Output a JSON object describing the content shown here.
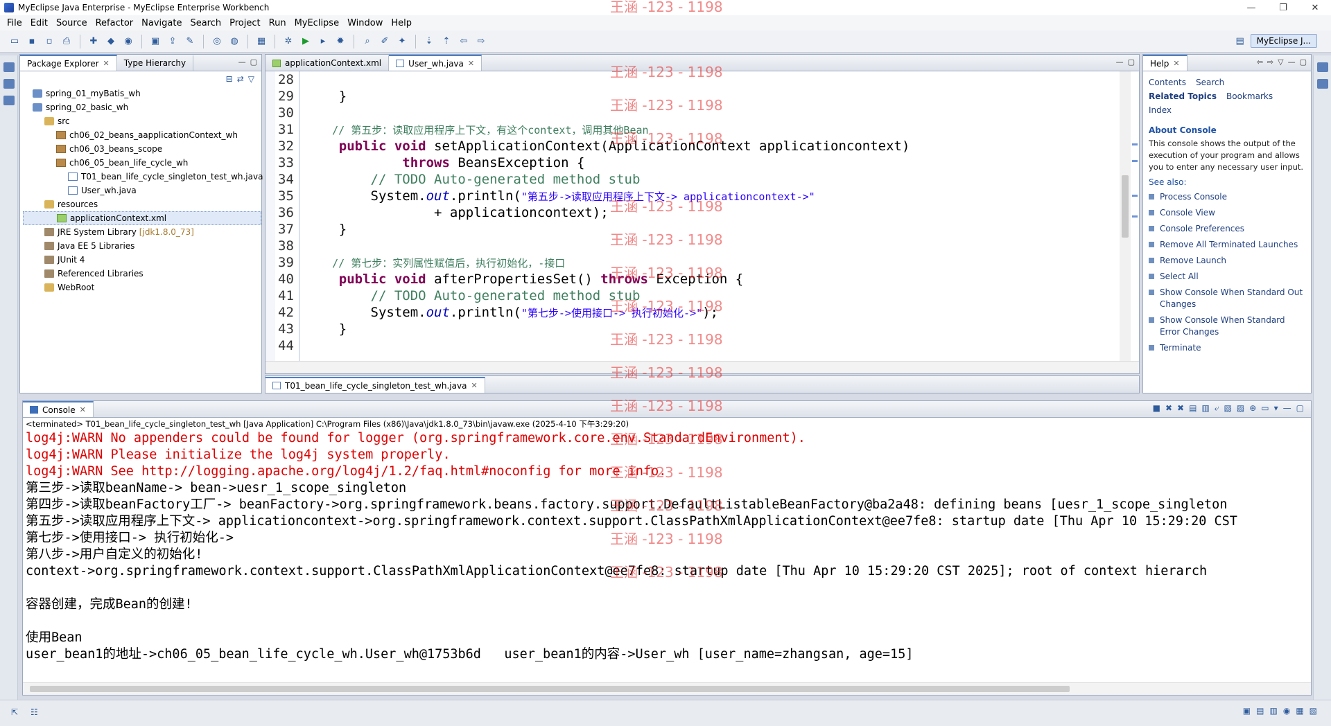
{
  "window": {
    "title": "MyEclipse Java Enterprise - MyEclipse Enterprise Workbench",
    "controls": [
      "—",
      "❐",
      "✕"
    ]
  },
  "menu": [
    "File",
    "Edit",
    "Source",
    "Refactor",
    "Navigate",
    "Search",
    "Project",
    "Run",
    "MyEclipse",
    "Window",
    "Help"
  ],
  "perspective": {
    "label": "MyEclipse J..."
  },
  "package_explorer": {
    "tabs": [
      "Package Explorer",
      "Type Hierarchy"
    ],
    "items": [
      {
        "label": "spring_01_myBatis_wh",
        "icon": "project-icon",
        "indent": 0
      },
      {
        "label": "spring_02_basic_wh",
        "icon": "project-icon",
        "indent": 0
      },
      {
        "label": "src",
        "icon": "folder-icon",
        "indent": 1
      },
      {
        "label": "ch06_02_beans_aapplicationContext_wh",
        "icon": "package-icon",
        "indent": 2
      },
      {
        "label": "ch06_03_beans_scope",
        "icon": "package-icon",
        "indent": 2
      },
      {
        "label": "ch06_05_bean_life_cycle_wh",
        "icon": "package-icon",
        "indent": 2
      },
      {
        "label": "T01_bean_life_cycle_singleton_test_wh.java",
        "icon": "java-file-icon",
        "indent": 3
      },
      {
        "label": "User_wh.java",
        "icon": "java-file-icon",
        "indent": 3
      },
      {
        "label": "resources",
        "icon": "folder-icon",
        "indent": 1
      },
      {
        "label": "applicationContext.xml",
        "icon": "xml-file-icon",
        "indent": 2,
        "selected": true
      },
      {
        "label": "JRE System Library",
        "icon": "library-icon",
        "indent": 1,
        "deco": "[jdk1.8.0_73]"
      },
      {
        "label": "Java EE 5 Libraries",
        "icon": "library-icon",
        "indent": 1
      },
      {
        "label": "JUnit 4",
        "icon": "library-icon",
        "indent": 1
      },
      {
        "label": "Referenced Libraries",
        "icon": "library-icon",
        "indent": 1
      },
      {
        "label": "WebRoot",
        "icon": "folder-icon",
        "indent": 1
      }
    ]
  },
  "editor": {
    "tabs": [
      "applicationContext.xml",
      "User_wh.java"
    ],
    "bottom_tab": "T01_bean_life_cycle_singleton_test_wh.java",
    "line_numbers": [
      "28",
      "29",
      "30",
      "31",
      "32",
      "33",
      "34",
      "35",
      "36",
      "37",
      "38",
      "39",
      "40",
      "41",
      "42",
      "43",
      "44"
    ],
    "lines": {
      "l29": "    }",
      "l31": "    // 第五步：读取应用程序上下文，有这个context，调用其他Bean",
      "l32_kw1": "public",
      "l32_kw2": "void",
      "l32_rest": " setApplicationContext(ApplicationContext applicationcontext)",
      "l33_kw": "throws",
      "l33_rest": " BeansException {",
      "l34": "        // TODO Auto-generated method stub",
      "l35_a": "        System.",
      "l35_b": "out",
      "l35_c": ".println(",
      "l35_str": "\"第五步->读取应用程序上下文-> applicationcontext->\"",
      "l36": "                + applicationcontext);",
      "l37": "    }",
      "l39": "    // 第七步：实列属性赋值后，执行初始化，-接口",
      "l40_kw1": "public",
      "l40_kw2": "void",
      "l40_mid": " afterPropertiesSet() ",
      "l40_kw3": "throws",
      "l40_rest": " Exception {",
      "l41": "        // TODO Auto-generated method stub",
      "l42_a": "        System.",
      "l42_b": "out",
      "l42_c": ".println(",
      "l42_str": "\"第七步->使用接口-> 执行初始化->\"",
      "l42_d": ");",
      "l43": "    }"
    }
  },
  "help": {
    "tab": "Help",
    "links": {
      "contents": "Contents",
      "search": "Search",
      "related": "Related Topics",
      "bookmarks": "Bookmarks",
      "index": "Index"
    },
    "heading": "About Console",
    "description": "This console shows the output of the execution of your program and allows you to enter any necessary user input.",
    "see_also": "See also:",
    "items": [
      "Process Console",
      "Console View",
      "Console Preferences",
      "Remove All Terminated Launches",
      "Remove Launch",
      "Select All",
      "Show Console When Standard Out Changes",
      "Show Console When Standard Error Changes",
      "Terminate"
    ]
  },
  "console": {
    "tab": "Console",
    "info": "<terminated> T01_bean_life_cycle_singleton_test_wh [Java Application] C:\\Program Files (x86)\\Java\\jdk1.8.0_73\\bin\\javaw.exe (2025-4-10 下午3:29:20)",
    "lines": [
      {
        "text": "log4j:WARN No appenders could be found for logger (org.springframework.core.env.StandardEnvironment).",
        "err": true
      },
      {
        "text": "log4j:WARN Please initialize the log4j system properly.",
        "err": true
      },
      {
        "text": "log4j:WARN See http://logging.apache.org/log4j/1.2/faq.html#noconfig for more info.",
        "err": true
      },
      {
        "text": "第三步->读取beanName-> bean->uesr_1_scope_singleton",
        "err": false
      },
      {
        "text": "第四步->读取beanFactory工厂-> beanFactory->org.springframework.beans.factory.support.DefaultListableBeanFactory@ba2a48: defining beans [uesr_1_scope_singleton",
        "err": false
      },
      {
        "text": "第五步->读取应用程序上下文-> applicationcontext->org.springframework.context.support.ClassPathXmlApplicationContext@ee7fe8: startup date [Thu Apr 10 15:29:20 CST",
        "err": false
      },
      {
        "text": "第七步->使用接口-> 执行初始化->",
        "err": false
      },
      {
        "text": "第八步->用户自定义的初始化!",
        "err": false
      },
      {
        "text": "context->org.springframework.context.support.ClassPathXmlApplicationContext@ee7fe8: startup date [Thu Apr 10 15:29:20 CST 2025]; root of context hierarch",
        "err": false
      },
      {
        "text": "",
        "err": false
      },
      {
        "text": "容器创建，完成Bean的创建!",
        "err": false
      },
      {
        "text": "",
        "err": false
      },
      {
        "text": "使用Bean",
        "err": false
      },
      {
        "text": "user_bean1的地址->ch06_05_bean_life_cycle_wh.User_wh@1753b6d   user_bean1的内容->User_wh [user_name=zhangsan, age=15]",
        "err": false
      }
    ]
  },
  "watermark": "王涵 -123 - 1198",
  "colors": {
    "accent": "#4d7fc9",
    "error_text": "#e00000",
    "keyword": "#7f0055",
    "comment": "#3f7f5f",
    "string": "#2a00ff"
  }
}
